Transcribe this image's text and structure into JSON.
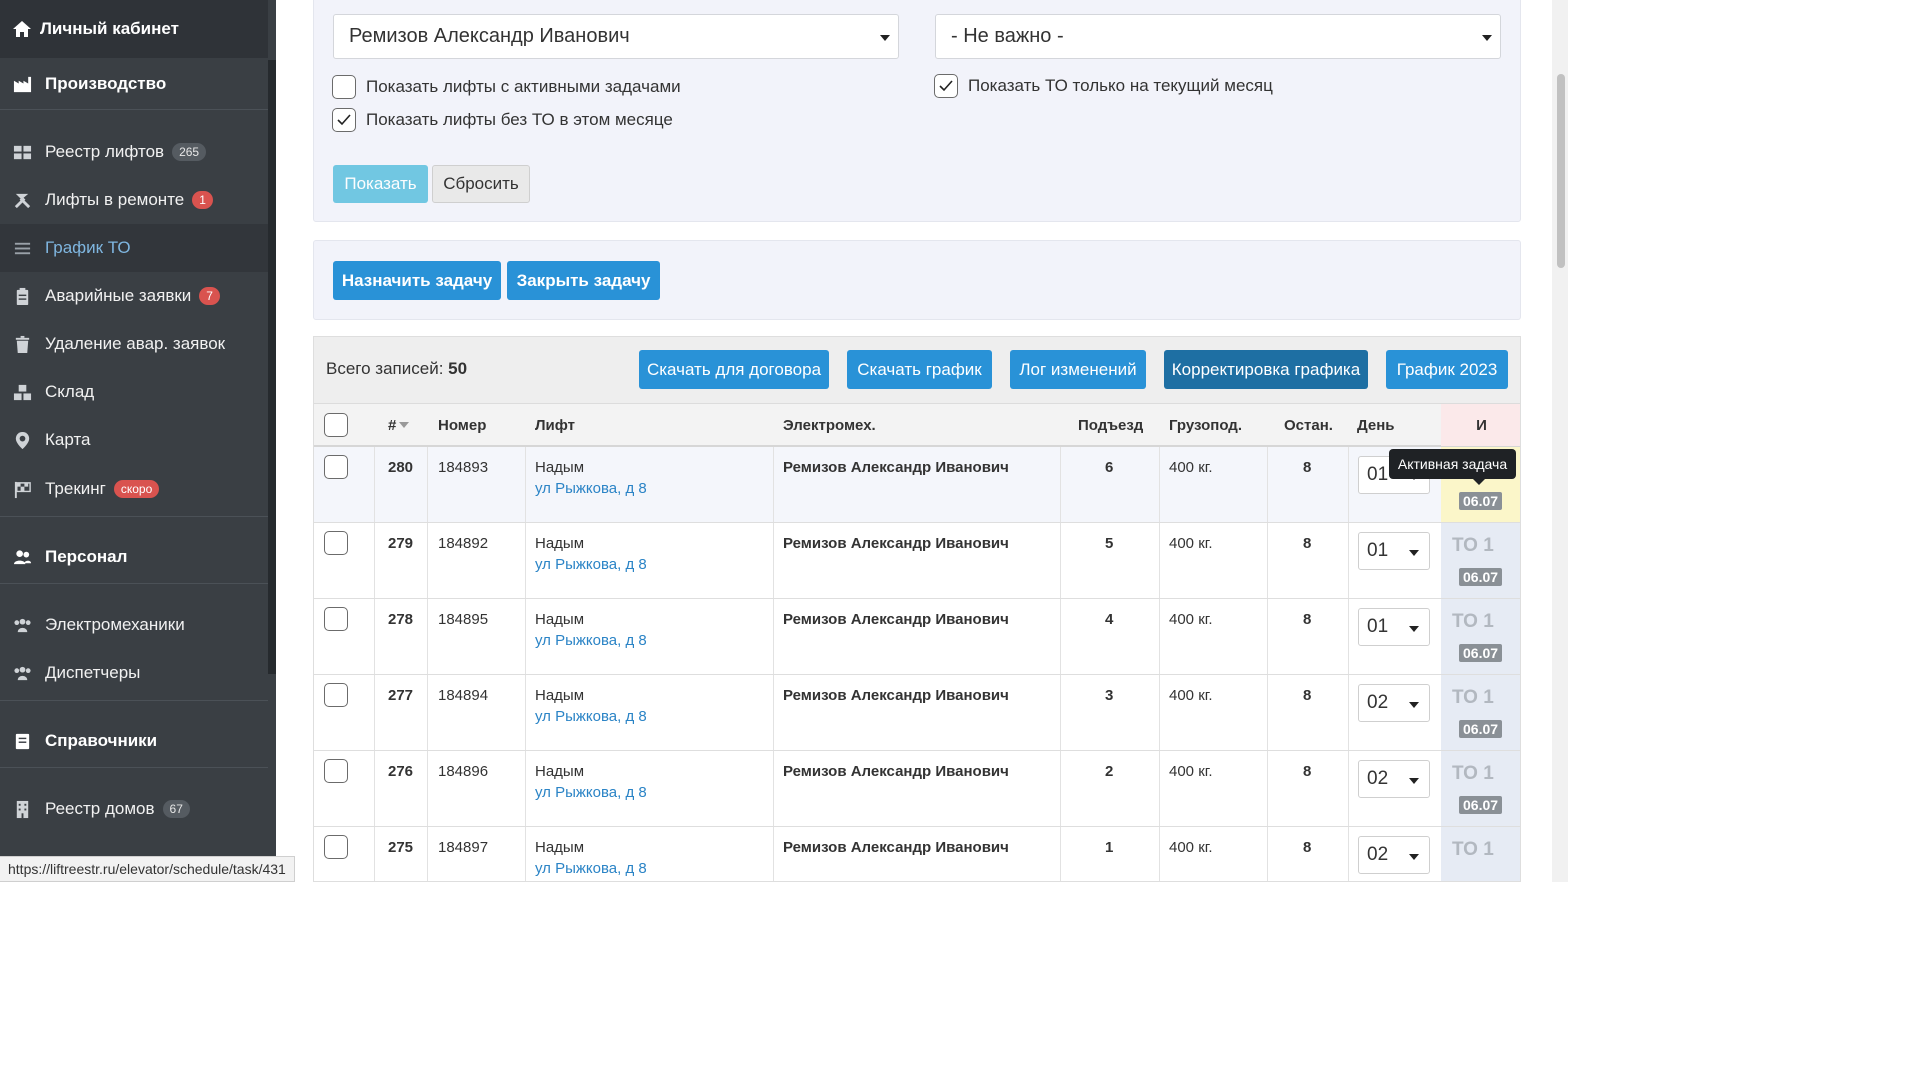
{
  "sidebar": {
    "top_label": "Личный кабинет",
    "items": [
      {
        "label": "Производство",
        "section": true
      },
      {
        "label": "Реестр лифтов",
        "badge": "265"
      },
      {
        "label": "Лифты в ремонте",
        "badge": "1"
      },
      {
        "label": "График ТО"
      },
      {
        "label": "Аварийные заявки",
        "badge": "7"
      },
      {
        "label": "Удаление авар. заявок"
      },
      {
        "label": "Склад"
      },
      {
        "label": "Карта"
      },
      {
        "label": "Трекинг",
        "badge": "скоро"
      },
      {
        "label": "Персонал",
        "section": true
      },
      {
        "label": "Электромеханики"
      },
      {
        "label": "Диспетчеры"
      },
      {
        "label": "Справочники",
        "section": true
      },
      {
        "label": "Реестр домов",
        "badge": "67"
      }
    ]
  },
  "filters": {
    "mechanic_value": "Ремизов Александр Иванович",
    "second_value": "- Не важно -",
    "chk_active_tasks": "Показать лифты с активными задачами",
    "chk_no_to": "Показать лифты без ТО в этом месяце",
    "chk_current_month": "Показать ТО только на текущий месяц",
    "show_btn": "Показать",
    "reset_btn": "Сбросить"
  },
  "actions": {
    "assign_task": "Назначить задачу",
    "close_task": "Закрыть задачу"
  },
  "toolbar": {
    "total_label": "Всего записей:",
    "total_value": "50",
    "btn_contract": "Скачать для договора",
    "btn_schedule": "Скачать график",
    "btn_log": "Лог изменений",
    "btn_correct": "Корректировка графика",
    "btn_2023": "График 2023"
  },
  "table": {
    "headers": {
      "num": "#",
      "number": "Номер",
      "lift": "Лифт",
      "mechanic": "Электромех.",
      "entrance": "Подъезд",
      "capacity": "Грузопод.",
      "stops": "Остан.",
      "day": "День",
      "last": "И"
    },
    "rows": [
      {
        "id": "280",
        "number": "184893",
        "city": "Надым",
        "address": "ул Рыжкова, д 8",
        "mechanic": "Ремизов Александр Иванович",
        "entrance": "6",
        "capacity": "400 кг.",
        "stops": "8",
        "day": "01",
        "to": "ТО 1",
        "date": "06.07"
      },
      {
        "id": "279",
        "number": "184892",
        "city": "Надым",
        "address": "ул Рыжкова, д 8",
        "mechanic": "Ремизов Александр Иванович",
        "entrance": "5",
        "capacity": "400 кг.",
        "stops": "8",
        "day": "01",
        "to": "ТО 1",
        "date": "06.07"
      },
      {
        "id": "278",
        "number": "184895",
        "city": "Надым",
        "address": "ул Рыжкова, д 8",
        "mechanic": "Ремизов Александр Иванович",
        "entrance": "4",
        "capacity": "400 кг.",
        "stops": "8",
        "day": "01",
        "to": "ТО 1",
        "date": "06.07"
      },
      {
        "id": "277",
        "number": "184894",
        "city": "Надым",
        "address": "ул Рыжкова, д 8",
        "mechanic": "Ремизов Александр Иванович",
        "entrance": "3",
        "capacity": "400 кг.",
        "stops": "8",
        "day": "02",
        "to": "ТО 1",
        "date": "06.07"
      },
      {
        "id": "276",
        "number": "184896",
        "city": "Надым",
        "address": "ул Рыжкова, д 8",
        "mechanic": "Ремизов Александр Иванович",
        "entrance": "2",
        "capacity": "400 кг.",
        "stops": "8",
        "day": "02",
        "to": "ТО 1",
        "date": "06.07"
      },
      {
        "id": "275",
        "number": "184897",
        "city": "Надым",
        "address": "ул Рыжкова, д 8",
        "mechanic": "Ремизов Александр Иванович",
        "entrance": "1",
        "capacity": "400 кг.",
        "stops": "8",
        "day": "02",
        "to": "ТО 1",
        "date": ""
      }
    ]
  },
  "tooltip": "Активная задача",
  "status_url": "https://liftreestr.ru/elevator/schedule/task/431",
  "colors": {
    "sidebar_bg": "#3a3f44",
    "accent": "#2992d7",
    "active_link": "#7fb6e0",
    "badge_red": "#d9534f"
  }
}
